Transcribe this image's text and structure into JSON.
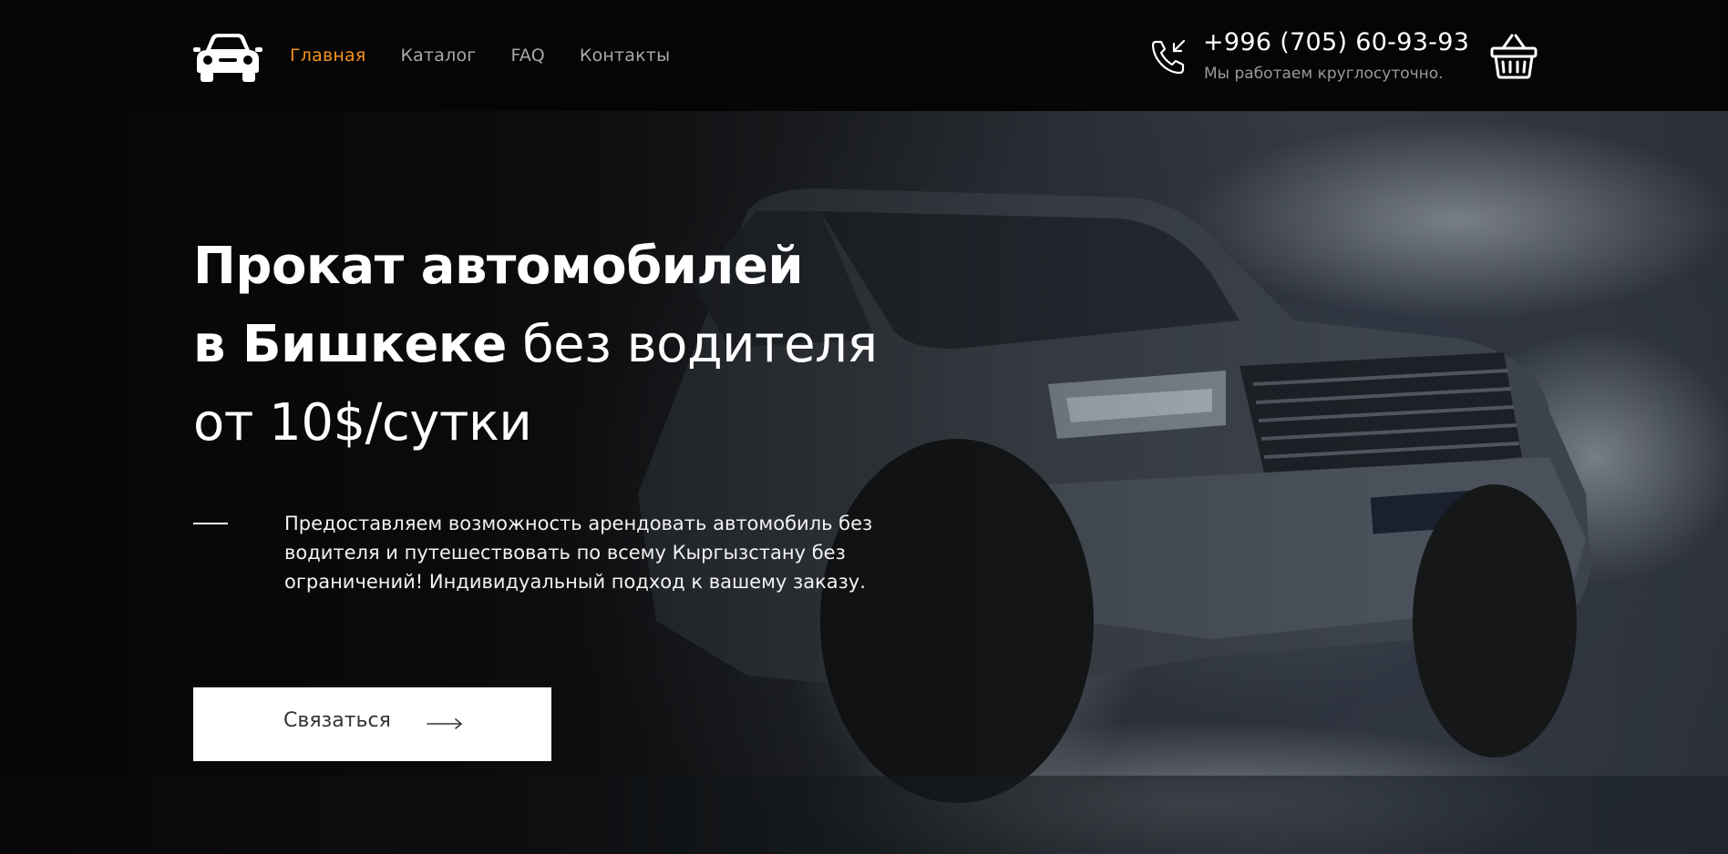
{
  "header": {
    "logo_icon": "car-icon",
    "nav": [
      {
        "label": "Главная",
        "active": true
      },
      {
        "label": "Каталог",
        "active": false
      },
      {
        "label": "FAQ",
        "active": false
      },
      {
        "label": "Контакты",
        "active": false
      }
    ],
    "phone_icon": "phone-call-icon",
    "phone_number": "+996 (705) 60-93-93",
    "phone_note": "Мы работаем круглосуточно.",
    "cart_icon": "basket-icon"
  },
  "hero": {
    "title_line1_bold": "Прокат автомобилей",
    "title_line2_bold": "в Бишкеке",
    "title_line2_light": " без водителя",
    "title_line3_light": "от 10$/сутки",
    "description": "Предоставляем возможность арендовать автомобиль без водителя и путешествовать по всему Кыргызстану без ограничений! Индивидуальный подход к вашему заказу.",
    "cta_label": "Связаться",
    "cta_icon": "arrow-right-icon",
    "background_icon": "suv-splash-image"
  },
  "colors": {
    "accent": "#f7931e",
    "header_bg": "#050505",
    "nav_text": "#a9a9a9",
    "button_bg": "#ffffff"
  }
}
